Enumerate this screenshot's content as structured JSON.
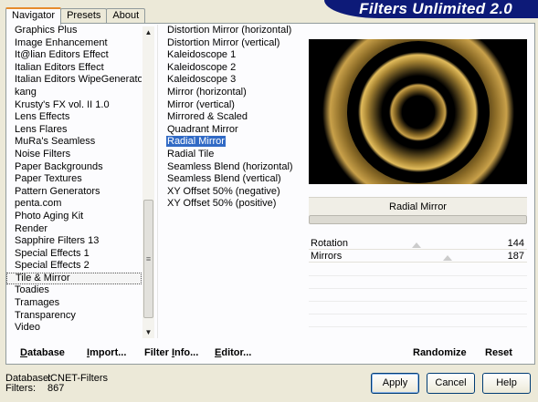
{
  "app": {
    "title": "Filters Unlimited 2.0"
  },
  "tabs": [
    {
      "label": "Navigator",
      "active": true
    },
    {
      "label": "Presets",
      "active": false
    },
    {
      "label": "About",
      "active": false
    }
  ],
  "categories": [
    "Graphics Plus",
    "Image Enhancement",
    "It@lian Editors Effect",
    "Italian Editors Effect",
    "Italian Editors WipeGenerator",
    "kang",
    "Krusty's FX vol. II 1.0",
    "Lens Effects",
    "Lens Flares",
    "MuRa's Seamless",
    "Noise Filters",
    "Paper Backgrounds",
    "Paper Textures",
    "Pattern Generators",
    "penta.com",
    "Photo Aging Kit",
    "Render",
    "Sapphire Filters 13",
    "Special Effects 1",
    "Special Effects 2",
    "Tile & Mirror",
    "Toadies",
    "Tramages",
    "Transparency",
    "Video"
  ],
  "selected_category": "Tile & Mirror",
  "filters": [
    "Distortion Mirror (horizontal)",
    "Distortion Mirror (vertical)",
    "Kaleidoscope 1",
    "Kaleidoscope 2",
    "Kaleidoscope 3",
    "Mirror (horizontal)",
    "Mirror (vertical)",
    "Mirrored & Scaled",
    "Quadrant Mirror",
    "Radial Mirror",
    "Radial Tile",
    "Seamless Blend (horizontal)",
    "Seamless Blend (vertical)",
    "XY Offset 50% (negative)",
    "XY Offset 50% (positive)"
  ],
  "selected_filter": "Radial Mirror",
  "current_filter_label": "Radial Mirror",
  "parameters": [
    {
      "name": "Rotation",
      "value": "144",
      "fraction": 0.565
    },
    {
      "name": "Mirrors",
      "value": "187",
      "fraction": 0.733
    }
  ],
  "left_toolbar": {
    "database": {
      "u": "D",
      "rest": "atabase"
    },
    "import": {
      "u": "I",
      "rest": "mport..."
    },
    "filter_info": {
      "pre": "Filter ",
      "u": "I",
      "rest": "nfo..."
    },
    "editor": {
      "u": "E",
      "rest": "ditor..."
    }
  },
  "right_toolbar": {
    "randomize": "Randomize",
    "reset": "Reset"
  },
  "info": {
    "database_label": "Database:",
    "database_value": "ICNET-Filters",
    "filters_label": "Filters:",
    "filters_value": "867"
  },
  "buttons": {
    "apply": "Apply",
    "cancel": "Cancel",
    "help": "Help"
  },
  "colors": {
    "banner": "#0d1a78",
    "selection": "#316ac5",
    "preview_ring": "#c9a14a"
  }
}
